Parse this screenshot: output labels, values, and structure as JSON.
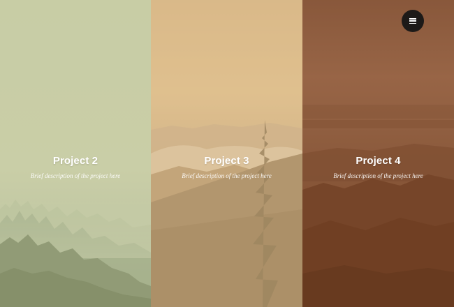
{
  "menu": {
    "icon": "hamburger-menu-icon",
    "color": "#1d1a18"
  },
  "projects": [
    {
      "title": "Project 2",
      "description": "Brief description of the project here",
      "tint": "#cbd0a6"
    },
    {
      "title": "Project 3",
      "description": "Brief description of the project here",
      "tint": "#dbb680"
    },
    {
      "title": "Project 4",
      "description": "Brief description of the project here",
      "tint": "#7c4626"
    }
  ]
}
